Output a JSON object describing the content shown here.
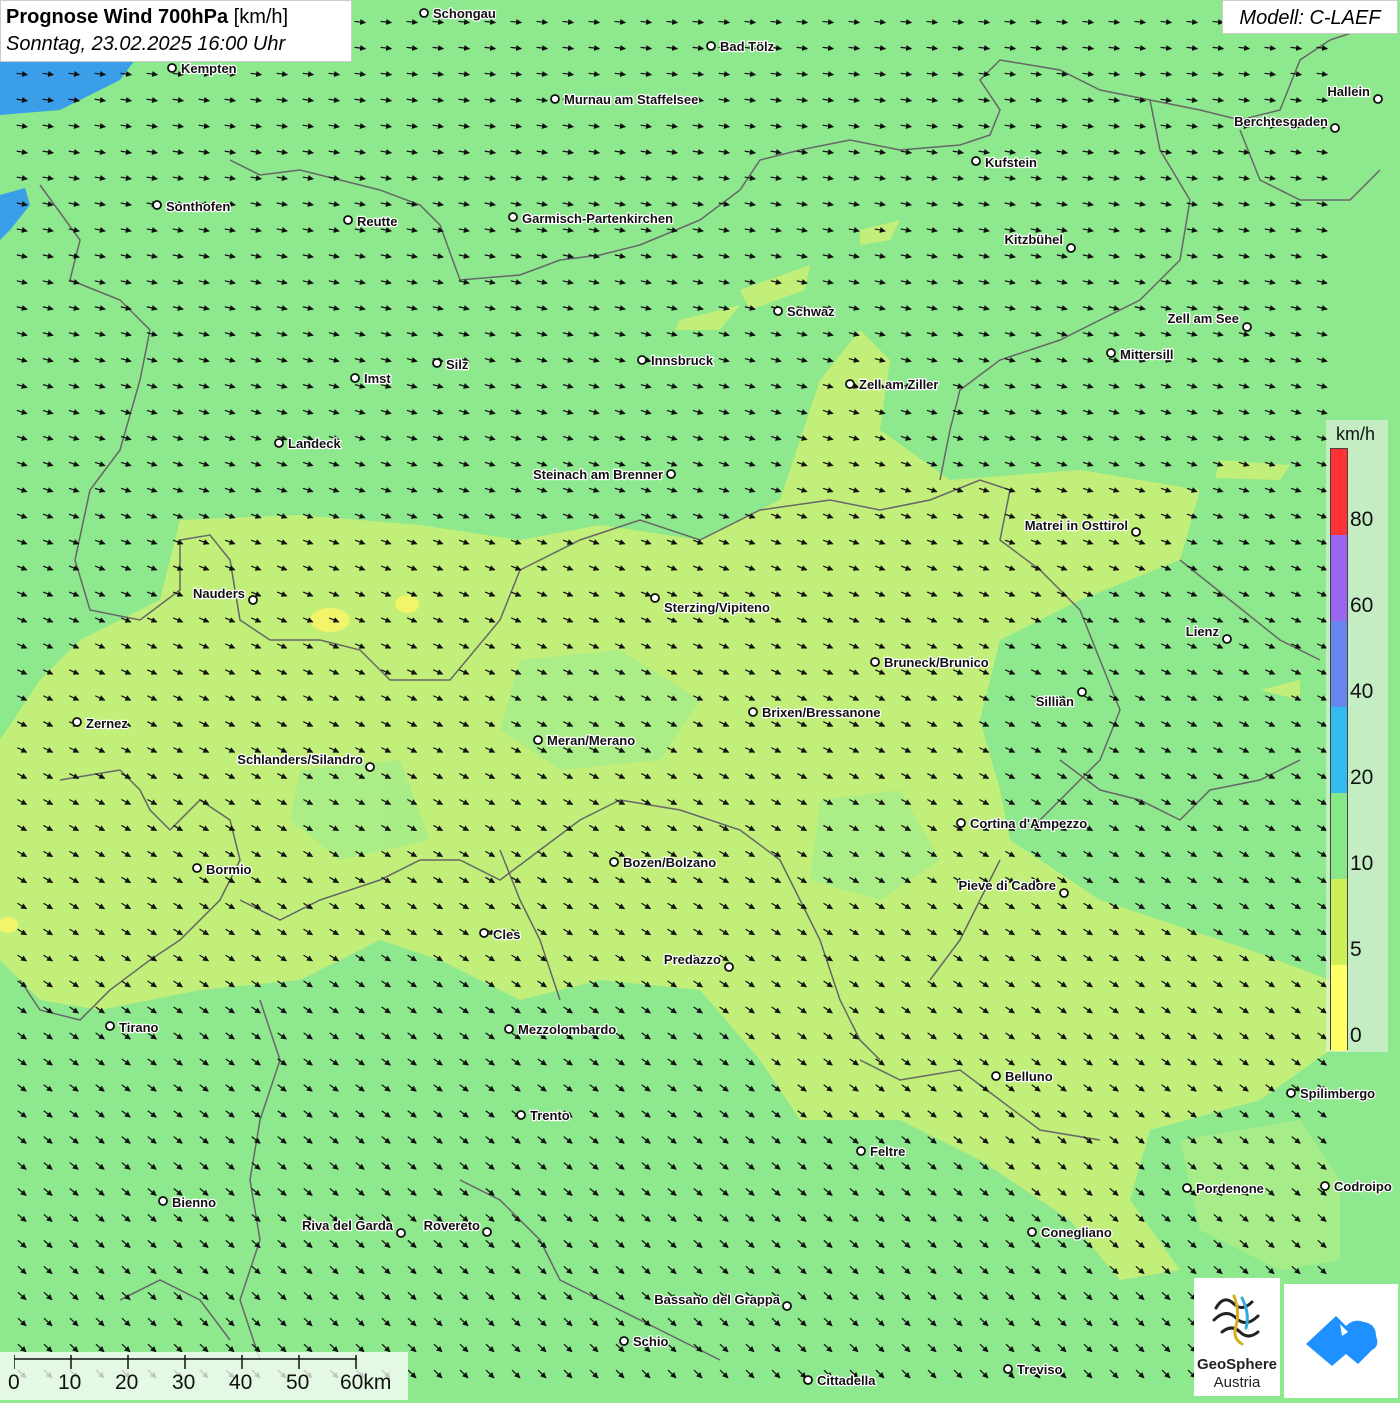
{
  "title": {
    "bold": "Prognose Wind 700hPa",
    "unit": "[km/h]",
    "datetime": "Sonntag, 23.02.2025 16:00 Uhr"
  },
  "model": "Modell: C-LAEF",
  "legend": {
    "unit": "km/h",
    "ticks": [
      "80",
      "60",
      "40",
      "20",
      "10",
      "5",
      "0"
    ],
    "colors": [
      "#ff3333",
      "#9966ee",
      "#6688ee",
      "#33bbee",
      "#88e888",
      "#ccf055",
      "#ffff66"
    ]
  },
  "scalebar": {
    "labels": [
      "0",
      "10",
      "20",
      "30",
      "40",
      "50",
      "60km"
    ]
  },
  "logo": {
    "line1": "GeoSphere",
    "line2": "Austria"
  },
  "cities": [
    {
      "name": "Schongau"
    },
    {
      "name": "Bad Tölz"
    },
    {
      "name": "Kempten"
    },
    {
      "name": "Murnau am Staffelsee"
    },
    {
      "name": "Hallein"
    },
    {
      "name": "Berchtesgaden"
    },
    {
      "name": "Kufstein"
    },
    {
      "name": "Sonthofen"
    },
    {
      "name": "Reutte"
    },
    {
      "name": "Garmisch-Partenkirchen"
    },
    {
      "name": "Kitzbühel"
    },
    {
      "name": "Schwaz"
    },
    {
      "name": "Zell am See"
    },
    {
      "name": "Mittersill"
    },
    {
      "name": "Innsbruck"
    },
    {
      "name": "Imst"
    },
    {
      "name": "Silz"
    },
    {
      "name": "Zell am Ziller"
    },
    {
      "name": "Landeck"
    },
    {
      "name": "Steinach am Brenner"
    },
    {
      "name": "Matrei in Osttirol"
    },
    {
      "name": "Nauders"
    },
    {
      "name": "Sterzing/Vipiteno"
    },
    {
      "name": "Lienz"
    },
    {
      "name": "Bruneck/Brunico"
    },
    {
      "name": "Sillian"
    },
    {
      "name": "Zernez"
    },
    {
      "name": "Brixen/Bressanone"
    },
    {
      "name": "Meran/Merano"
    },
    {
      "name": "Schlanders/Silandro"
    },
    {
      "name": "Cortina d'Ampezzo"
    },
    {
      "name": "Bormio"
    },
    {
      "name": "Bozen/Bolzano"
    },
    {
      "name": "Pieve di Cadore"
    },
    {
      "name": "Cles"
    },
    {
      "name": "Predazzo"
    },
    {
      "name": "Tirano"
    },
    {
      "name": "Mezzolombardo"
    },
    {
      "name": "Belluno"
    },
    {
      "name": "Spilimbergo"
    },
    {
      "name": "Trento"
    },
    {
      "name": "Feltre"
    },
    {
      "name": "Pordenone"
    },
    {
      "name": "Codroipo"
    },
    {
      "name": "Bienno"
    },
    {
      "name": "Riva del Garda"
    },
    {
      "name": "Rovereto"
    },
    {
      "name": "Conegliano"
    },
    {
      "name": "Bassano del Grappa"
    },
    {
      "name": "Schio"
    },
    {
      "name": "Treviso"
    },
    {
      "name": "Cittadella"
    }
  ]
}
